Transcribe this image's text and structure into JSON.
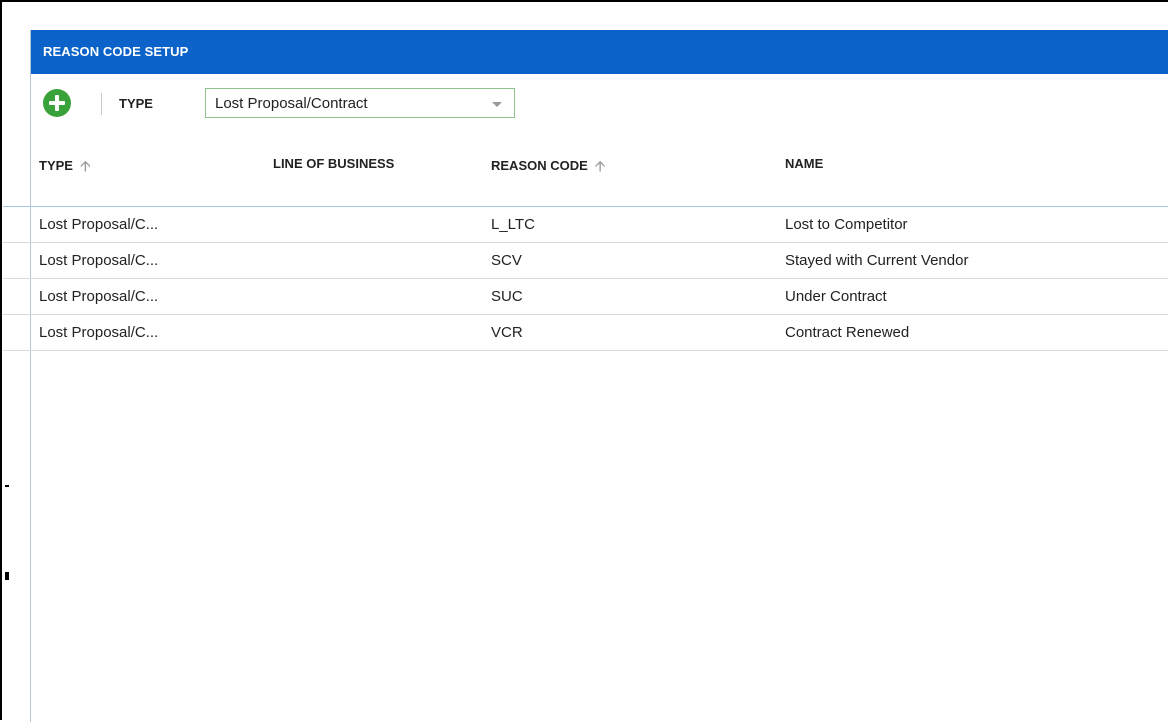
{
  "panel": {
    "title": "REASON CODE SETUP"
  },
  "toolbar": {
    "add_icon": "plus-circle-icon",
    "type_label": "TYPE",
    "type_selected": "Lost Proposal/Contract",
    "add_color": "#3aa23a"
  },
  "columns": {
    "type": "TYPE",
    "line_of_business": "LINE OF BUSINESS",
    "reason_code": "REASON CODE",
    "name": "NAME",
    "sort_icon": "arrow-up-icon"
  },
  "rows": [
    {
      "type": "Lost Proposal/C...",
      "line_of_business": "",
      "reason_code": "L_LTC",
      "name": "Lost to Competitor"
    },
    {
      "type": "Lost Proposal/C...",
      "line_of_business": "",
      "reason_code": "SCV",
      "name": "Stayed with Current Vendor"
    },
    {
      "type": "Lost Proposal/C...",
      "line_of_business": "",
      "reason_code": "SUC",
      "name": "Under Contract"
    },
    {
      "type": "Lost Proposal/C...",
      "line_of_business": "",
      "reason_code": "VCR",
      "name": "Contract Renewed"
    }
  ],
  "colors": {
    "title_bar": "#0b63c9",
    "header_separator": "#a9c6e8",
    "select_border": "#8fc28f"
  }
}
